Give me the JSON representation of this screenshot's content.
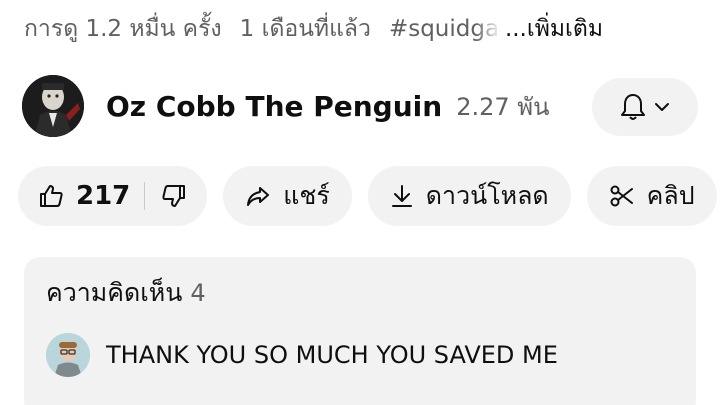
{
  "meta": {
    "views": "การดู 1.2 หมื่น ครั้ง",
    "age": "1 เดือนที่แล้ว",
    "hashtag": "#squidgame",
    "more": "...เพิ่มเติม"
  },
  "channel": {
    "name": "Oz Cobb The Penguin",
    "subscribers": "2.27 พัน"
  },
  "actions": {
    "likes": "217",
    "share_label": "แชร์",
    "download_label": "ดาวน์โหลด",
    "clip_label": "คลิป"
  },
  "comments": {
    "header": "ความคิดเห็น",
    "count": "4",
    "top_comment": "THANK YOU SO MUCH YOU SAVED ME"
  },
  "icons": {
    "like": "thumbs-up-icon",
    "dislike": "thumbs-down-icon",
    "share": "share-arrow-icon",
    "download": "download-icon",
    "clip": "scissors-icon",
    "bell": "bell-icon",
    "chevron": "chevron-down-icon"
  },
  "colors": {
    "pill_bg": "#f2f2f2",
    "secondary_text": "#606060",
    "primary_text": "#0f0f0f"
  }
}
